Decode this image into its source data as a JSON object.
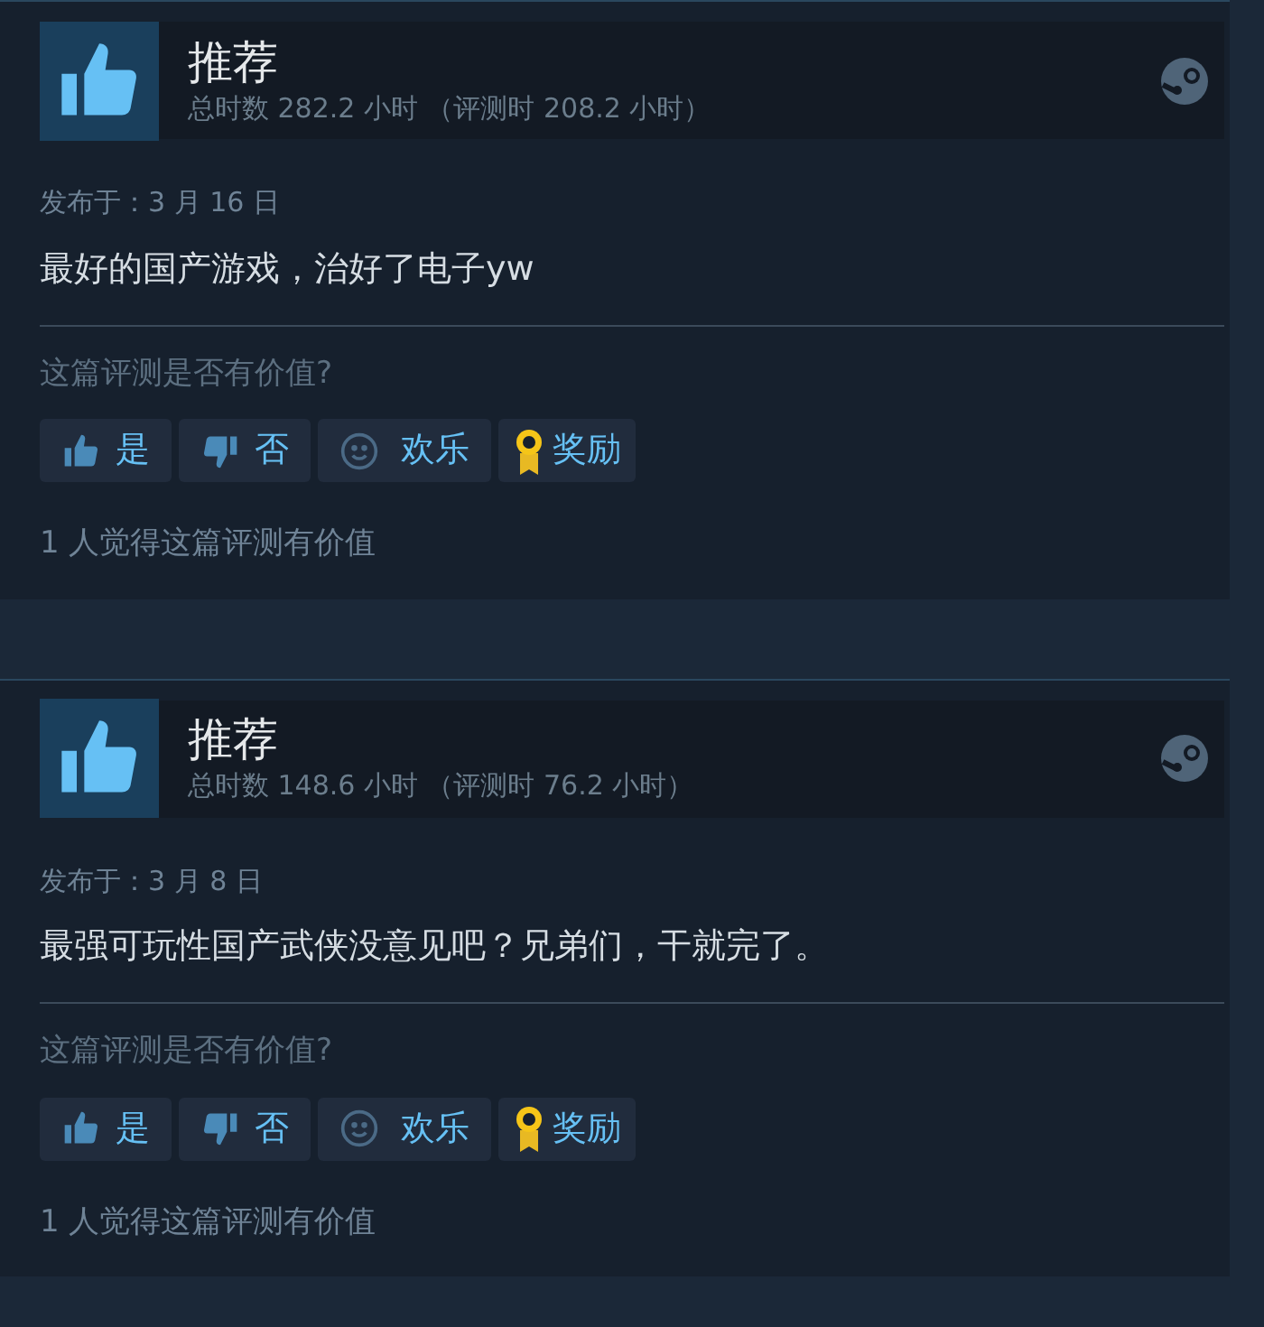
{
  "reviews": [
    {
      "recommended": true,
      "title": "推荐",
      "hours": "总时数 282.2 小时 （评测时 208.2 小时）",
      "date": "发布于：3 月 16 日",
      "text": "最好的国产游戏，治好了电子yw",
      "question": "这篇评测是否有价值?",
      "buttons": [
        {
          "kind": "up",
          "label": "是"
        },
        {
          "kind": "down",
          "label": "否"
        },
        {
          "kind": "funny",
          "label": "欢乐"
        },
        {
          "kind": "award",
          "label": "奖励"
        }
      ],
      "helpful": "1 人觉得这篇评测有价值"
    },
    {
      "recommended": true,
      "title": "推荐",
      "hours": "总时数 148.6 小时 （评测时 76.2 小时）",
      "date": "发布于：3 月 8 日",
      "text": "最强可玩性国产武侠没意见吧？兄弟们，干就完了。",
      "question": "这篇评测是否有价值?",
      "buttons": [
        {
          "kind": "up",
          "label": "是"
        },
        {
          "kind": "down",
          "label": "否"
        },
        {
          "kind": "funny",
          "label": "欢乐"
        },
        {
          "kind": "award",
          "label": "奖励"
        }
      ],
      "helpful": "1 人觉得这篇评测有价值"
    }
  ]
}
